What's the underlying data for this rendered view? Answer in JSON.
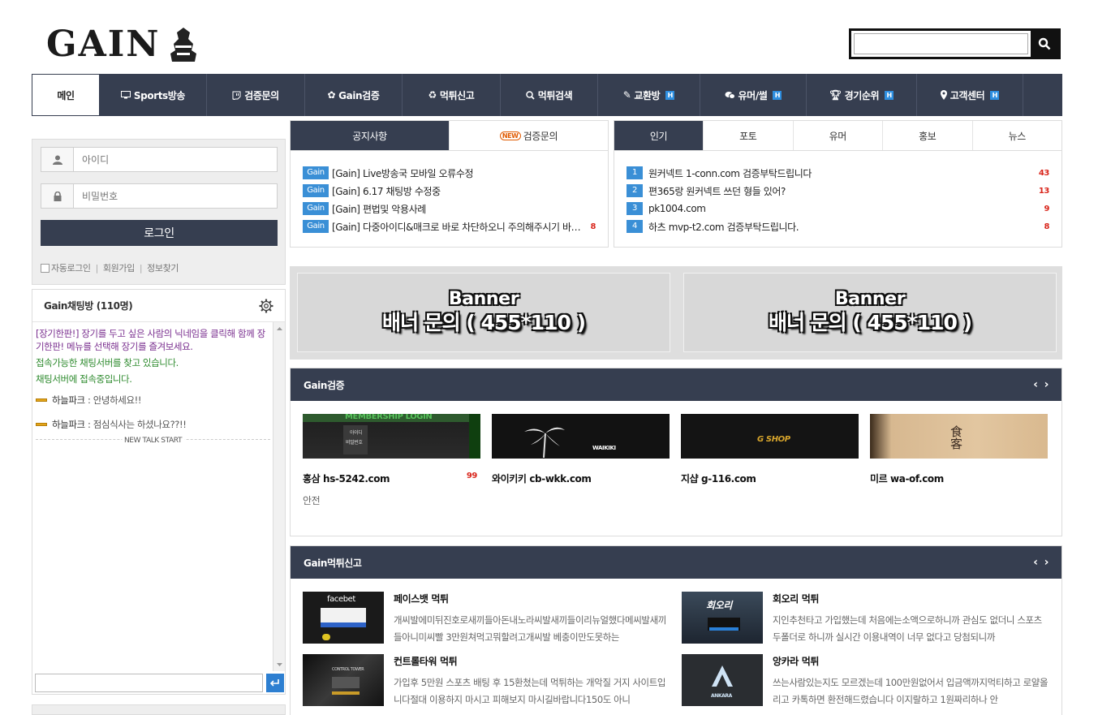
{
  "logo": {
    "text": "GAIN"
  },
  "search": {
    "placeholder": ""
  },
  "nav": [
    {
      "label": "메인",
      "icon": "",
      "badge": ""
    },
    {
      "label": "Sports방송",
      "icon": "monitor-icon",
      "badge": ""
    },
    {
      "label": "검증문의",
      "icon": "twitch-icon",
      "badge": ""
    },
    {
      "label": "Gain검증",
      "icon": "flower-icon",
      "badge": ""
    },
    {
      "label": "먹튀신고",
      "icon": "recycle-icon",
      "badge": ""
    },
    {
      "label": "먹튀검색",
      "icon": "zoom-icon",
      "badge": ""
    },
    {
      "label": "교환방",
      "icon": "brush-icon",
      "badge": "H"
    },
    {
      "label": "유머/썰",
      "icon": "chat-icon",
      "badge": "H"
    },
    {
      "label": "경기순위",
      "icon": "trophy-icon",
      "badge": "H"
    },
    {
      "label": "고객센터",
      "icon": "pin-icon",
      "badge": "H"
    }
  ],
  "login": {
    "id_placeholder": "아이디",
    "pw_placeholder": "비밀번호",
    "button": "로그인",
    "auto_login": "자동로그인",
    "join": "회원가입",
    "find": "정보찾기",
    "sep": "|"
  },
  "chat": {
    "title": "Gain채팅방 (110명)",
    "notice": "[장기한판!] 장기를 두고 싶은 사람의 닉네임을 클릭해 함께 장기한판! 메뉴를 선택해 장기를 즐겨보세요.",
    "status1": "접속가능한 채팅서버를 찾고 있습니다.",
    "status2": "채팅서버에 접속중입니다.",
    "messages": [
      {
        "user": "하늘파크",
        "text": " : 안녕하세요!!"
      },
      {
        "user": "하늘파크",
        "text": " : 점심식사는 하셨나요??!!"
      }
    ],
    "talk_start": "NEW TALK START"
  },
  "notice_box": {
    "tabs": [
      "공지사항",
      "검증문의"
    ],
    "new_badge": "NEW",
    "tag": "Gain",
    "items": [
      {
        "text": "[Gain] Live방송국 모바일 오류수정",
        "count": ""
      },
      {
        "text": "[Gain] 6.17 채팅방 수정중",
        "count": ""
      },
      {
        "text": "[Gain] 편법및 악용사례",
        "count": ""
      },
      {
        "text": "[Gain] 다중아이디&매크로 바로 차단하오니 주의해주시기 바랍니다",
        "count": "8"
      }
    ]
  },
  "popular_box": {
    "tabs": [
      "인기",
      "포토",
      "유머",
      "홍보",
      "뉴스"
    ],
    "items": [
      {
        "num": "1",
        "text": "원커넥트 1-conn.com 검증부탁드립니다",
        "count": "43"
      },
      {
        "num": "2",
        "text": "편365랑 원커넥트 쓰던 형들 있어?",
        "count": "13"
      },
      {
        "num": "3",
        "text": "pk1004.com",
        "count": "9"
      },
      {
        "num": "4",
        "text": "하츠 mvp-t2.com 검증부탁드립니다.",
        "count": "8"
      }
    ]
  },
  "banners": [
    {
      "line1": "Banner",
      "line2": "배너 문의 ( 455*110 )"
    },
    {
      "line1": "Banner",
      "line2": "배너 문의 ( 455*110 )"
    }
  ],
  "verify": {
    "title": "Gain검증",
    "prev": "‹",
    "next": "›",
    "cards": [
      {
        "title": "홍삼 hs-5242.com",
        "count": "99",
        "sub": "안전",
        "img_text": "MEMBERSHIP LOGIN",
        "img_sub1": "아이디",
        "img_sub2": "비밀번호"
      },
      {
        "title": "와이키키 cb-wkk.com",
        "count": "",
        "sub": "",
        "img_text": "WAIKIKI"
      },
      {
        "title": "지샵 g-116.com",
        "count": "",
        "sub": "",
        "img_text": "G SHOP"
      },
      {
        "title": "미르 wa-of.com",
        "count": "",
        "sub": "",
        "img_text": "食客"
      }
    ]
  },
  "reports": {
    "title": "Gain먹튀신고",
    "prev": "‹",
    "next": "›",
    "cards": [
      {
        "title": "페이스뱃 먹튀",
        "desc": "개씨발에미뒤진호로새끼들아돈내노라씨발새끼들이리뉴얼했다메씨발새끼들아니미씨빨 3만원쳐먹고뭐할려고개씨발 베충이만도못하는",
        "img_text": "facebet"
      },
      {
        "title": "회오리 먹튀",
        "desc": "지인추천타고 가입했는데 처음에는소액으로하니까 관심도 없더니 스포츠 두폴더로 하니까 실시간 이용내역이 너무 없다고 당첨되니까",
        "img_text": "회오리"
      },
      {
        "title": "컨트롤타워 먹튀",
        "desc": "가입후 5만원 스포츠 배팅 후 15환쳤는데 먹튀하는 개악질 거지 사이트입니다절대 이용하지 마시고 피해보지 마시길바랍니다150도 아니",
        "img_text": "CONTROL TOWER"
      },
      {
        "title": "앙카라 먹튀",
        "desc": "쓰는사람있는지도 모르겠는데 100만원없어서 입금액까지먹티하고 로얄올리고 카톡하면 환전해드렸습니다 이지랄하고 1원짜리하나 안",
        "img_text": "ANKARA"
      }
    ]
  }
}
